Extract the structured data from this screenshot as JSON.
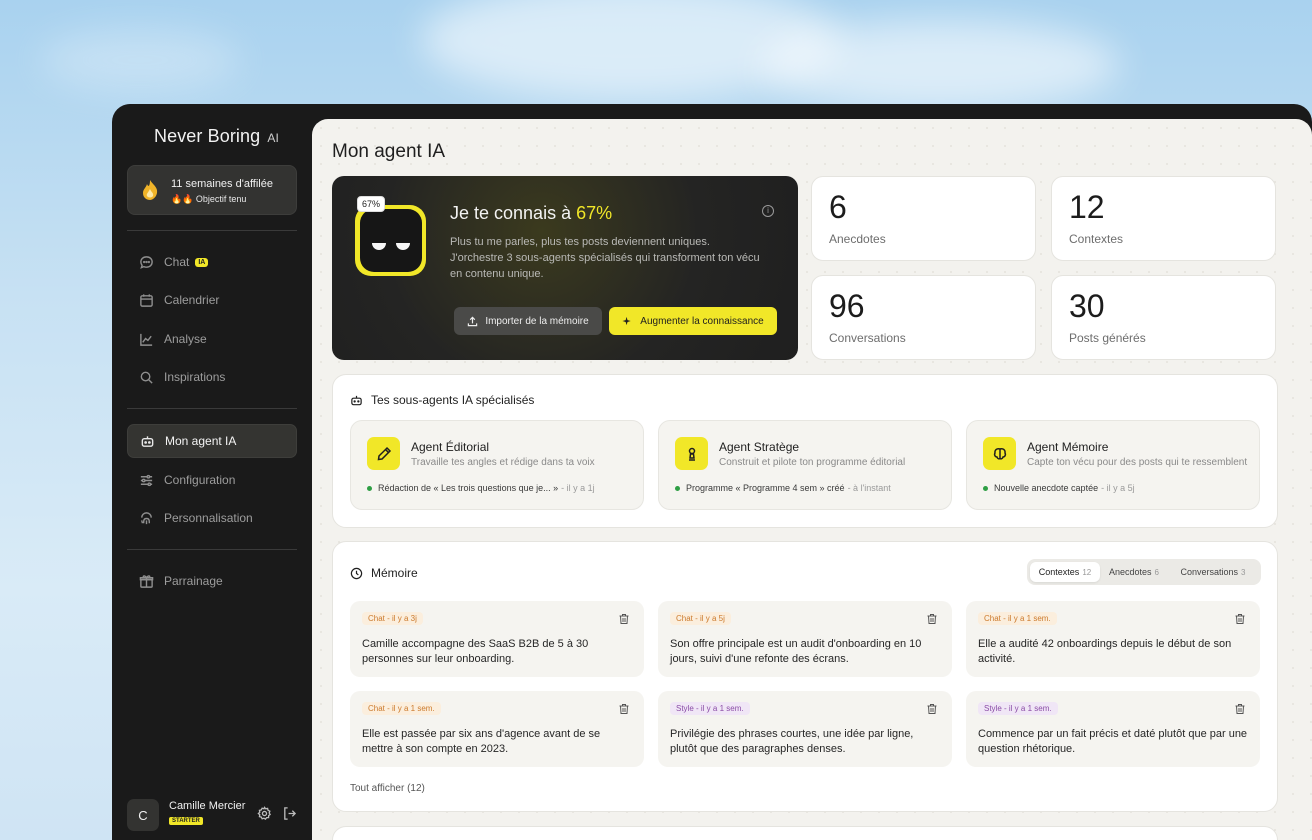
{
  "sidebar": {
    "brand": "Never Boring",
    "brand_suffix": "AI",
    "streak": {
      "title": "11 semaines d'affilée",
      "subtitle": "🔥🔥 Objectif tenu"
    },
    "nav": [
      {
        "label": "Chat",
        "badge": "IA",
        "icon": "chat-icon"
      },
      {
        "label": "Calendrier",
        "icon": "calendar-icon"
      },
      {
        "label": "Analyse",
        "icon": "chart-icon"
      },
      {
        "label": "Inspirations",
        "icon": "search-icon"
      },
      {
        "label": "Mon agent IA",
        "icon": "robot-icon"
      },
      {
        "label": "Configuration",
        "icon": "sliders-icon"
      },
      {
        "label": "Personnalisation",
        "icon": "fingerprint-icon"
      },
      {
        "label": "Parrainage",
        "icon": "gift-icon"
      }
    ],
    "user": {
      "initial": "C",
      "name": "Camille Mercier",
      "plan": "STARTER"
    }
  },
  "main": {
    "title": "Mon agent IA",
    "hero": {
      "chip": "67%",
      "heading_prefix": "Je te connais à ",
      "heading_pct": "67%",
      "description": "Plus tu me parles, plus tes posts deviennent uniques. J'orchestre 3 sous-agents spécialisés qui transforment ton vécu en contenu unique.",
      "info": "i",
      "import_label": "Importer de la mémoire",
      "boost_label": "Augmenter la connaissance"
    },
    "stats": [
      {
        "value": "6",
        "label": "Anecdotes"
      },
      {
        "value": "12",
        "label": "Contextes"
      },
      {
        "value": "96",
        "label": "Conversations"
      },
      {
        "value": "30",
        "label": "Posts générés"
      }
    ],
    "agents_title": "Tes sous-agents IA spécialisés",
    "agents": [
      {
        "name": "Agent Éditorial",
        "desc": "Travaille tes angles et rédige dans ta voix",
        "activity": "Rédaction de « Les trois questions que je... »",
        "time": "- il y a 1j",
        "icon": "pen-icon"
      },
      {
        "name": "Agent Stratège",
        "desc": "Construit et pilote ton programme éditorial",
        "activity": "Programme « Programme 4 sem » créé",
        "time": "- à l'instant",
        "icon": "chess-icon"
      },
      {
        "name": "Agent Mémoire",
        "desc": "Capte ton vécu pour des posts qui te ressemblent",
        "activity": "Nouvelle anecdote captée",
        "time": "- il y a 5j",
        "icon": "brain-icon"
      }
    ],
    "memory": {
      "title": "Mémoire",
      "tabs": [
        {
          "label": "Contextes",
          "count": "12"
        },
        {
          "label": "Anecdotes",
          "count": "6"
        },
        {
          "label": "Conversations",
          "count": "3"
        }
      ],
      "items": [
        {
          "tag": "Chat - il y a 3j",
          "kind": "chat",
          "text": "Camille accompagne des SaaS B2B de 5 à 30 personnes sur leur onboarding."
        },
        {
          "tag": "Chat - il y a 5j",
          "kind": "chat",
          "text": "Son offre principale est un audit d'onboarding en 10 jours, suivi d'une refonte des écrans."
        },
        {
          "tag": "Chat - il y a 1 sem.",
          "kind": "chat",
          "text": "Elle a audité 42 onboardings depuis le début de son activité."
        },
        {
          "tag": "Chat - il y a 1 sem.",
          "kind": "chat",
          "text": "Elle est passée par six ans d'agence avant de se mettre à son compte en 2023."
        },
        {
          "tag": "Style - il y a 1 sem.",
          "kind": "style",
          "text": "Privilégie des phrases courtes, une idée par ligne, plutôt que des paragraphes denses."
        },
        {
          "tag": "Style - il y a 1 sem.",
          "kind": "style",
          "text": "Commence par un fait précis et daté plutôt que par une question rhétorique."
        }
      ],
      "show_all": "Tout afficher (12)"
    }
  }
}
